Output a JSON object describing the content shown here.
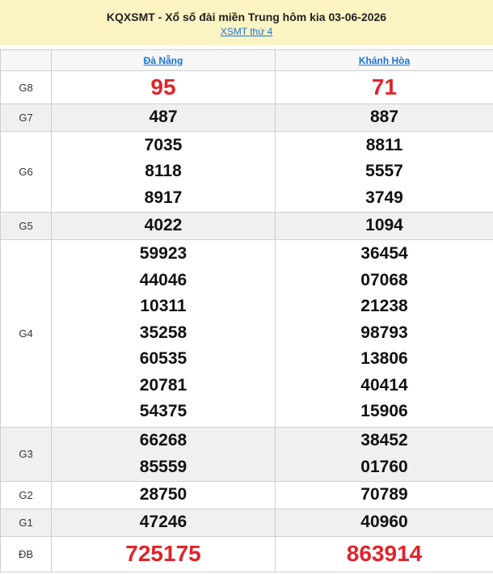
{
  "header": {
    "title": "KQXSMT - Xổ số đài miền Trung hôm kia 03-06-2026",
    "link": "XSMT thứ 4"
  },
  "provinces": [
    "Đà Nẵng",
    "Khánh Hòa"
  ],
  "colors": {
    "highlight": "#e0242b",
    "link": "#1a73d6",
    "header_bg": "#fdf4c4"
  },
  "prizes": [
    {
      "label": "G8",
      "p1": [
        "95"
      ],
      "p2": [
        "71"
      ]
    },
    {
      "label": "G7",
      "p1": [
        "487"
      ],
      "p2": [
        "887"
      ]
    },
    {
      "label": "G6",
      "p1": [
        "7035",
        "8118",
        "8917"
      ],
      "p2": [
        "8811",
        "5557",
        "3749"
      ]
    },
    {
      "label": "G5",
      "p1": [
        "4022"
      ],
      "p2": [
        "1094"
      ]
    },
    {
      "label": "G4",
      "p1": [
        "59923",
        "44046",
        "10311",
        "35258",
        "60535",
        "20781",
        "54375"
      ],
      "p2": [
        "36454",
        "07068",
        "21238",
        "98793",
        "13806",
        "40414",
        "15906"
      ]
    },
    {
      "label": "G3",
      "p1": [
        "66268",
        "85559"
      ],
      "p2": [
        "38452",
        "01760"
      ]
    },
    {
      "label": "G2",
      "p1": [
        "28750"
      ],
      "p2": [
        "70789"
      ]
    },
    {
      "label": "G1",
      "p1": [
        "47246"
      ],
      "p2": [
        "40960"
      ]
    },
    {
      "label": "ĐB",
      "p1": [
        "725175"
      ],
      "p2": [
        "863914"
      ]
    }
  ]
}
